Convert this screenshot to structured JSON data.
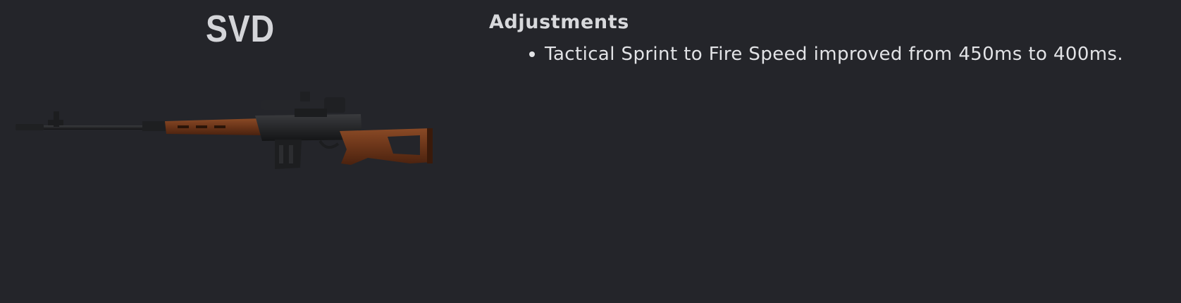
{
  "weapon": {
    "name": "SVD",
    "image_icon": "svd-rifle-icon"
  },
  "changes": {
    "heading": "Adjustments",
    "items": [
      "Tactical Sprint to Fire Speed improved from 450ms to 400ms."
    ]
  },
  "colors": {
    "background": "#24252a",
    "text": "#e2e3e6",
    "wood": "#6b3519",
    "metal": "#1c1d1f"
  }
}
